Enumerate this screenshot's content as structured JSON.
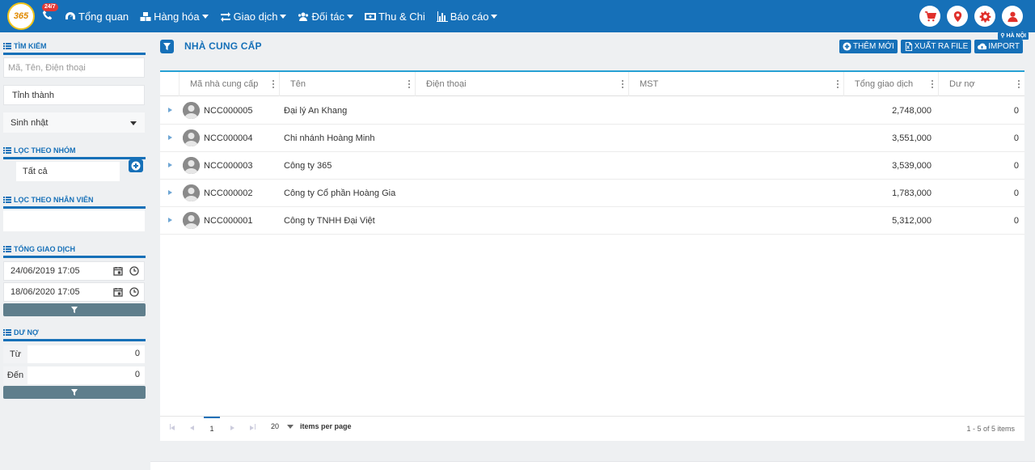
{
  "brand": {
    "logo_text": "365",
    "hotline_badge": "24/7"
  },
  "nav": {
    "items": [
      {
        "label": "Tổng quan",
        "icon": "dashboard-icon",
        "dropdown": false
      },
      {
        "label": "Hàng hóa",
        "icon": "cubes-icon",
        "dropdown": true
      },
      {
        "label": "Giao dịch",
        "icon": "exchange-icon",
        "dropdown": true
      },
      {
        "label": "Đối tác",
        "icon": "users-icon",
        "dropdown": true
      },
      {
        "label": "Thu & Chi",
        "icon": "money-icon",
        "dropdown": false
      },
      {
        "label": "Báo cáo",
        "icon": "bar-chart-icon",
        "dropdown": true
      }
    ]
  },
  "top_right_icons": [
    "cart-icon",
    "map-marker-icon",
    "gear-icon",
    "user-icon"
  ],
  "sidebar": {
    "search": {
      "title": "TÌM KIẾM",
      "placeholder": "Mã, Tên, Điện thoại",
      "province": "Tỉnh thành",
      "birthday": "Sinh nhật"
    },
    "group": {
      "title": "LỌC THEO NHÓM",
      "all": "Tất cả"
    },
    "staff": {
      "title": "LỌC THEO NHÂN VIÊN"
    },
    "total": {
      "title": "TỔNG GIAO DỊCH",
      "from_date": "24/06/2019 17:05",
      "to_date": "18/06/2020 17:05"
    },
    "debt": {
      "title": "DƯ NỢ",
      "from_label": "Từ",
      "from_value": "0",
      "to_label": "Đến",
      "to_value": "0"
    }
  },
  "main": {
    "title": "NHÀ CUNG CẤP",
    "region": "HÀ NỘI",
    "actions": {
      "add": "THÊM MỚI",
      "export": "XUẤT RA FILE",
      "import": "IMPORT"
    },
    "columns": [
      "Mã nhà cung cấp",
      "Tên",
      "Điện thoại",
      "MST",
      "Tổng giao dịch",
      "Dư nợ"
    ],
    "rows": [
      {
        "code": "NCC000005",
        "name": "Đại lý An Khang",
        "phone": "",
        "tax": "",
        "total": "2,748,000",
        "debt": "0"
      },
      {
        "code": "NCC000004",
        "name": "Chi nhánh Hoàng Minh",
        "phone": "",
        "tax": "",
        "total": "3,551,000",
        "debt": "0"
      },
      {
        "code": "NCC000003",
        "name": "Công ty 365",
        "phone": "",
        "tax": "",
        "total": "3,539,000",
        "debt": "0"
      },
      {
        "code": "NCC000002",
        "name": "Công ty Cổ phần Hoàng Gia",
        "phone": "",
        "tax": "",
        "total": "1,783,000",
        "debt": "0"
      },
      {
        "code": "NCC000001",
        "name": "Công ty TNHH Đại Việt",
        "phone": "",
        "tax": "",
        "total": "5,312,000",
        "debt": "0"
      }
    ],
    "pager": {
      "page": "1",
      "page_size": "20",
      "items_per_page": "items per page",
      "info": "1 - 5 of 5 items"
    }
  },
  "colors": {
    "primary": "#1670b8",
    "accent": "#27a1d4",
    "danger": "#e0302b",
    "filter_button": "#5f7e8c"
  }
}
